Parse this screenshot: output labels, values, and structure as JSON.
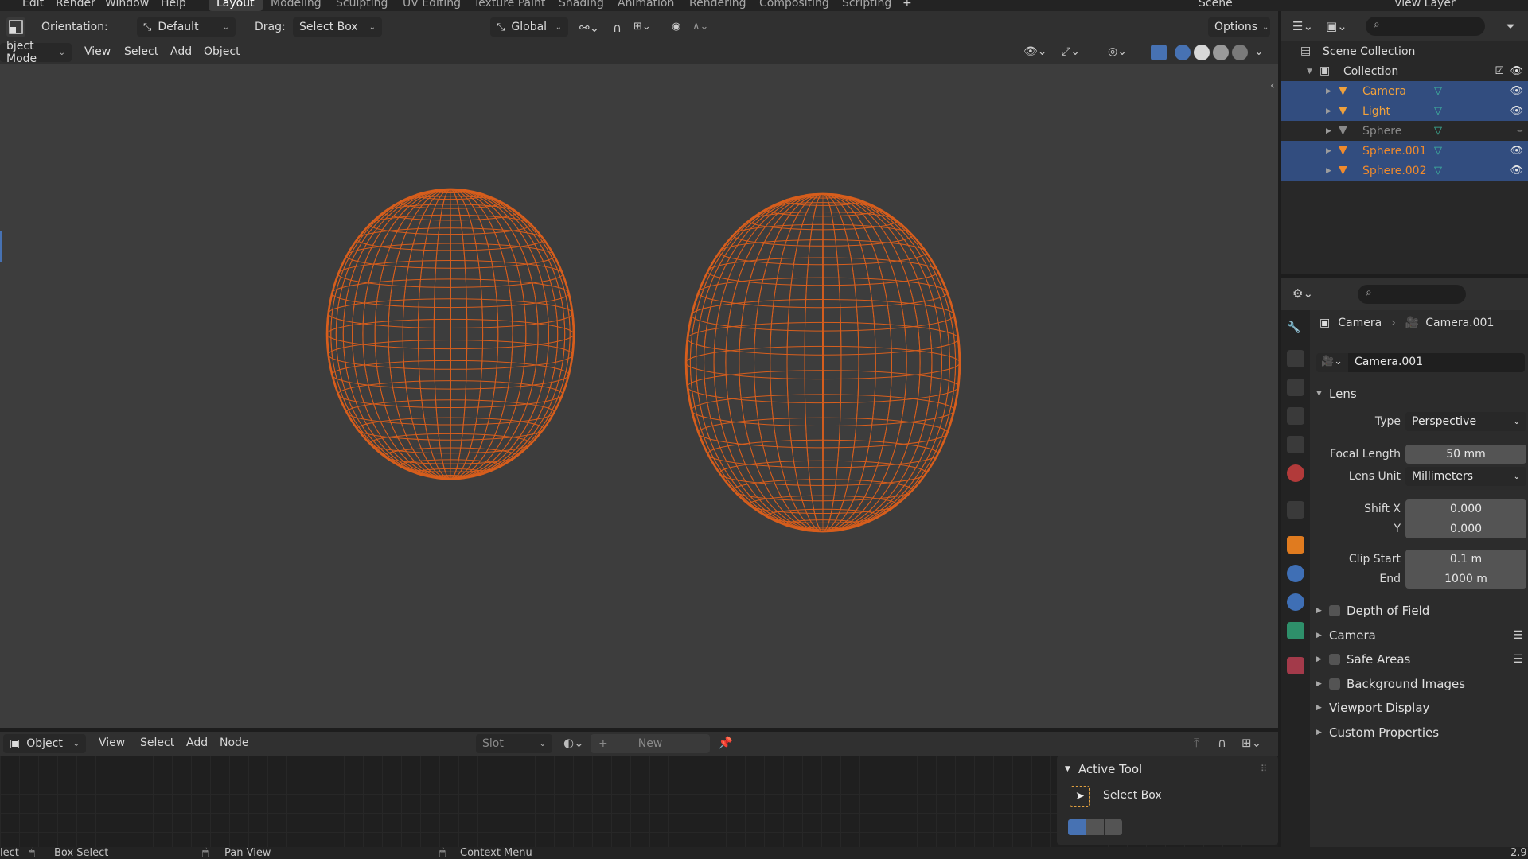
{
  "topbar": {
    "menus": [
      "Edit",
      "Render",
      "Window",
      "Help"
    ],
    "workspaces": [
      "Layout",
      "Modeling",
      "Sculpting",
      "UV Editing",
      "Texture Paint",
      "Shading",
      "Animation",
      "Rendering",
      "Compositing",
      "Scripting"
    ],
    "active_workspace": "Layout",
    "add_tab": "+",
    "scene_label": "Scene",
    "view_layer_label": "View Layer"
  },
  "toolheader": {
    "orientation_label": "Orientation:",
    "orientation_value": "Default",
    "drag_label": "Drag:",
    "drag_value": "Select Box",
    "transform_value": "Global",
    "options_label": "Options"
  },
  "viewheader": {
    "mode": "bject Mode",
    "menus": [
      "View",
      "Select",
      "Add",
      "Object"
    ]
  },
  "outliner": {
    "scene_collection": "Scene Collection",
    "collection": "Collection",
    "items": [
      {
        "name": "Camera",
        "selected": true,
        "color": "#f0a13c",
        "visible": true
      },
      {
        "name": "Light",
        "selected": true,
        "color": "#f0a13c",
        "visible": true
      },
      {
        "name": "Sphere",
        "selected": false,
        "color": "#8a8a8a",
        "visible": false
      },
      {
        "name": "Sphere.001",
        "selected": true,
        "color": "#f08a2c",
        "visible": true
      },
      {
        "name": "Sphere.002",
        "selected": true,
        "color": "#f08a2c",
        "visible": true
      }
    ]
  },
  "properties": {
    "breadcrumb_object": "Camera",
    "breadcrumb_data": "Camera.001",
    "datablock_name": "Camera.001",
    "lens_panel": "Lens",
    "type_label": "Type",
    "type_value": "Perspective",
    "focal_label": "Focal Length",
    "focal_value": "50 mm",
    "lens_unit_label": "Lens Unit",
    "lens_unit_value": "Millimeters",
    "shift_x_label": "Shift X",
    "shift_x_value": "0.000",
    "shift_y_label": "Y",
    "shift_y_value": "0.000",
    "clip_start_label": "Clip Start",
    "clip_start_value": "0.1 m",
    "clip_end_label": "End",
    "clip_end_value": "1000 m",
    "panels": [
      {
        "label": "Depth of Field",
        "checkbox": true,
        "list": false
      },
      {
        "label": "Camera",
        "checkbox": false,
        "list": true
      },
      {
        "label": "Safe Areas",
        "checkbox": true,
        "list": true
      },
      {
        "label": "Background Images",
        "checkbox": true,
        "list": false
      },
      {
        "label": "Viewport Display",
        "checkbox": false,
        "list": false
      },
      {
        "label": "Custom Properties",
        "checkbox": false,
        "list": false
      }
    ]
  },
  "shader": {
    "mode": "Object",
    "menus": [
      "View",
      "Select",
      "Add",
      "Node"
    ],
    "slot": "Slot",
    "new_label": "New"
  },
  "active_tool": {
    "title": "Active Tool",
    "tool": "Select Box"
  },
  "statusbar": {
    "left": "lect",
    "box_select": "Box Select",
    "pan_view": "Pan View",
    "context_menu": "Context Menu",
    "version": "2.9"
  },
  "colors": {
    "wire": "#e8621a",
    "selection": "#324d7f",
    "accent": "#f0a13c"
  }
}
